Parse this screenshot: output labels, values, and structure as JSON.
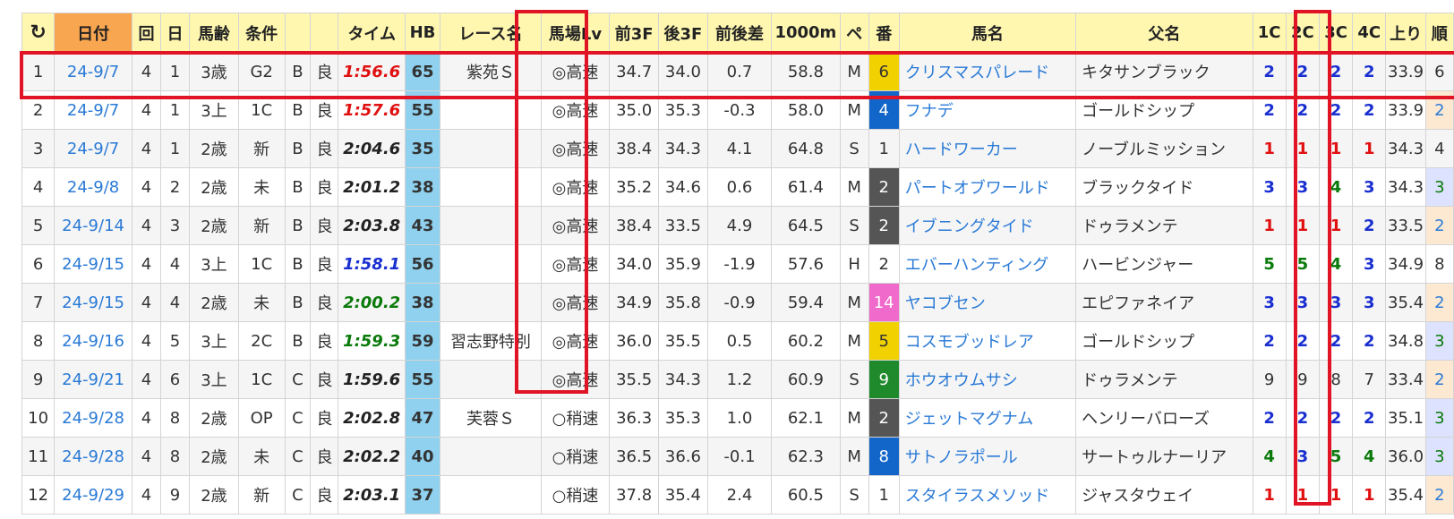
{
  "header": {
    "refresh_icon": "↻",
    "columns": [
      "日付",
      "回",
      "日",
      "馬齢",
      "条件",
      "",
      "",
      "タイム",
      "HB",
      "レース名",
      "馬場Lv",
      "前3F",
      "後3F",
      "前後差",
      "1000m",
      "ペ",
      "番",
      "馬名",
      "父名",
      "1C",
      "2C",
      "3C",
      "4C",
      "上り",
      "順"
    ]
  },
  "rows": [
    {
      "no": "1",
      "date": "24-9/7",
      "kai": "4",
      "day": "1",
      "age": "3歳",
      "cls": "G2",
      "course": "B",
      "cond": "良",
      "time": "1:56.6",
      "time_color": "red",
      "hb": "65",
      "race": "紫苑Ｓ",
      "lv": "◎高速",
      "f3": "34.7",
      "l3": "34.0",
      "diff": "0.7",
      "m1000": "58.8",
      "pace": "M",
      "ban": "6",
      "ban_color": "yellow",
      "horse": "クリスマスパレード",
      "sire": "キタサンブラック",
      "c1": "2",
      "c2": "2",
      "c3": "2",
      "c4": "2",
      "c1c": "blue",
      "c2c": "blue",
      "c3c": "blue",
      "c4c": "blue",
      "agari": "33.9",
      "rank": "6",
      "rank_hl": ""
    },
    {
      "no": "2",
      "date": "24-9/7",
      "kai": "4",
      "day": "1",
      "age": "3上",
      "cls": "1C",
      "course": "B",
      "cond": "良",
      "time": "1:57.6",
      "time_color": "red",
      "hb": "55",
      "race": "",
      "lv": "◎高速",
      "f3": "35.0",
      "l3": "35.3",
      "diff": "-0.3",
      "m1000": "58.0",
      "pace": "M",
      "ban": "4",
      "ban_color": "blue",
      "horse": "フナデ",
      "sire": "ゴールドシップ",
      "c1": "2",
      "c2": "2",
      "c3": "2",
      "c4": "2",
      "c1c": "blue",
      "c2c": "blue",
      "c3c": "blue",
      "c4c": "blue",
      "agari": "33.9",
      "rank": "2",
      "rank_hl": "orange"
    },
    {
      "no": "3",
      "date": "24-9/7",
      "kai": "4",
      "day": "1",
      "age": "2歳",
      "cls": "新",
      "course": "B",
      "cond": "良",
      "time": "2:04.6",
      "time_color": "black",
      "hb": "35",
      "race": "",
      "lv": "◎高速",
      "f3": "38.4",
      "l3": "34.3",
      "diff": "4.1",
      "m1000": "64.8",
      "pace": "S",
      "ban": "1",
      "ban_color": "plain",
      "horse": "ハードワーカー",
      "sire": "ノーブルミッション",
      "c1": "1",
      "c2": "1",
      "c3": "1",
      "c4": "1",
      "c1c": "red",
      "c2c": "red",
      "c3c": "red",
      "c4c": "red",
      "agari": "34.3",
      "rank": "4",
      "rank_hl": ""
    },
    {
      "no": "4",
      "date": "24-9/8",
      "kai": "4",
      "day": "2",
      "age": "2歳",
      "cls": "未",
      "course": "B",
      "cond": "良",
      "time": "2:01.2",
      "time_color": "black",
      "hb": "38",
      "race": "",
      "lv": "◎高速",
      "f3": "35.2",
      "l3": "34.6",
      "diff": "0.6",
      "m1000": "61.4",
      "pace": "M",
      "ban": "2",
      "ban_color": "gray",
      "horse": "パートオブワールド",
      "sire": "ブラックタイド",
      "c1": "3",
      "c2": "3",
      "c3": "4",
      "c4": "3",
      "c1c": "blue",
      "c2c": "blue",
      "c3c": "green",
      "c4c": "blue",
      "agari": "34.3",
      "rank": "3",
      "rank_hl": "lavender"
    },
    {
      "no": "5",
      "date": "24-9/14",
      "kai": "4",
      "day": "3",
      "age": "2歳",
      "cls": "新",
      "course": "B",
      "cond": "良",
      "time": "2:03.8",
      "time_color": "black",
      "hb": "43",
      "race": "",
      "lv": "◎高速",
      "f3": "38.4",
      "l3": "33.5",
      "diff": "4.9",
      "m1000": "64.5",
      "pace": "S",
      "ban": "2",
      "ban_color": "gray",
      "horse": "イブニングタイド",
      "sire": "ドゥラメンテ",
      "c1": "1",
      "c2": "1",
      "c3": "1",
      "c4": "2",
      "c1c": "red",
      "c2c": "red",
      "c3c": "red",
      "c4c": "blue",
      "agari": "33.5",
      "rank": "2",
      "rank_hl": "orange"
    },
    {
      "no": "6",
      "date": "24-9/15",
      "kai": "4",
      "day": "4",
      "age": "3上",
      "cls": "1C",
      "course": "B",
      "cond": "良",
      "time": "1:58.1",
      "time_color": "blue",
      "hb": "56",
      "race": "",
      "lv": "◎高速",
      "f3": "34.0",
      "l3": "35.9",
      "diff": "-1.9",
      "m1000": "57.6",
      "pace": "H",
      "ban": "2",
      "ban_color": "plain",
      "horse": "エバーハンティング",
      "sire": "ハービンジャー",
      "c1": "5",
      "c2": "5",
      "c3": "4",
      "c4": "3",
      "c1c": "green",
      "c2c": "green",
      "c3c": "green",
      "c4c": "blue",
      "agari": "34.9",
      "rank": "8",
      "rank_hl": ""
    },
    {
      "no": "7",
      "date": "24-9/15",
      "kai": "4",
      "day": "4",
      "age": "2歳",
      "cls": "未",
      "course": "B",
      "cond": "良",
      "time": "2:00.2",
      "time_color": "green",
      "hb": "38",
      "race": "",
      "lv": "◎高速",
      "f3": "34.9",
      "l3": "35.8",
      "diff": "-0.9",
      "m1000": "59.4",
      "pace": "M",
      "ban": "14",
      "ban_color": "pink",
      "horse": "ヤコブセン",
      "sire": "エピファネイア",
      "c1": "3",
      "c2": "3",
      "c3": "3",
      "c4": "3",
      "c1c": "blue",
      "c2c": "blue",
      "c3c": "blue",
      "c4c": "blue",
      "agari": "35.4",
      "rank": "2",
      "rank_hl": "orange"
    },
    {
      "no": "8",
      "date": "24-9/16",
      "kai": "4",
      "day": "5",
      "age": "3上",
      "cls": "2C",
      "course": "B",
      "cond": "良",
      "time": "1:59.3",
      "time_color": "green",
      "hb": "59",
      "race": "習志野特別",
      "lv": "◎高速",
      "f3": "36.0",
      "l3": "35.5",
      "diff": "0.5",
      "m1000": "60.2",
      "pace": "M",
      "ban": "5",
      "ban_color": "yellow",
      "horse": "コスモブッドレア",
      "sire": "ゴールドシップ",
      "c1": "2",
      "c2": "2",
      "c3": "2",
      "c4": "2",
      "c1c": "blue",
      "c2c": "blue",
      "c3c": "blue",
      "c4c": "blue",
      "agari": "34.8",
      "rank": "3",
      "rank_hl": "lavender"
    },
    {
      "no": "9",
      "date": "24-9/21",
      "kai": "4",
      "day": "6",
      "age": "3上",
      "cls": "1C",
      "course": "C",
      "cond": "良",
      "time": "1:59.6",
      "time_color": "black",
      "hb": "55",
      "race": "",
      "lv": "◎高速",
      "f3": "35.5",
      "l3": "34.3",
      "diff": "1.2",
      "m1000": "60.9",
      "pace": "S",
      "ban": "9",
      "ban_color": "green",
      "horse": "ホウオウムサシ",
      "sire": "ドゥラメンテ",
      "c1": "9",
      "c2": "9",
      "c3": "8",
      "c4": "7",
      "c1c": "plain",
      "c2c": "plain",
      "c3c": "plain",
      "c4c": "plain",
      "agari": "33.4",
      "rank": "2",
      "rank_hl": "orange"
    },
    {
      "no": "10",
      "date": "24-9/28",
      "kai": "4",
      "day": "8",
      "age": "2歳",
      "cls": "OP",
      "course": "C",
      "cond": "良",
      "time": "2:02.8",
      "time_color": "black",
      "hb": "47",
      "race": "芙蓉Ｓ",
      "lv": "○稍速",
      "f3": "36.3",
      "l3": "35.3",
      "diff": "1.0",
      "m1000": "62.1",
      "pace": "M",
      "ban": "2",
      "ban_color": "gray",
      "horse": "ジェットマグナム",
      "sire": "ヘンリーバローズ",
      "c1": "2",
      "c2": "2",
      "c3": "2",
      "c4": "2",
      "c1c": "blue",
      "c2c": "blue",
      "c3c": "blue",
      "c4c": "blue",
      "agari": "35.1",
      "rank": "3",
      "rank_hl": "lavender"
    },
    {
      "no": "11",
      "date": "24-9/28",
      "kai": "4",
      "day": "8",
      "age": "2歳",
      "cls": "未",
      "course": "C",
      "cond": "良",
      "time": "2:02.2",
      "time_color": "black",
      "hb": "40",
      "race": "",
      "lv": "○稍速",
      "f3": "36.5",
      "l3": "36.6",
      "diff": "-0.1",
      "m1000": "62.3",
      "pace": "M",
      "ban": "8",
      "ban_color": "blue",
      "horse": "サトノラポール",
      "sire": "サートゥルナーリア",
      "c1": "4",
      "c2": "3",
      "c3": "5",
      "c4": "4",
      "c1c": "green",
      "c2c": "blue",
      "c3c": "green",
      "c4c": "green",
      "agari": "36.0",
      "rank": "3",
      "rank_hl": "lavender"
    },
    {
      "no": "12",
      "date": "24-9/29",
      "kai": "4",
      "day": "9",
      "age": "2歳",
      "cls": "新",
      "course": "C",
      "cond": "良",
      "time": "2:03.1",
      "time_color": "black",
      "hb": "37",
      "race": "",
      "lv": "○稍速",
      "f3": "37.8",
      "l3": "35.4",
      "diff": "2.4",
      "m1000": "60.5",
      "pace": "S",
      "ban": "1",
      "ban_color": "plain",
      "horse": "スタイラスメソッド",
      "sire": "ジャスタウェイ",
      "c1": "1",
      "c2": "1",
      "c3": "1",
      "c4": "1",
      "c1c": "red",
      "c2c": "red",
      "c3c": "red",
      "c4c": "red",
      "agari": "35.4",
      "rank": "2",
      "rank_hl": "orange"
    }
  ],
  "highlight_color": "#e01425"
}
